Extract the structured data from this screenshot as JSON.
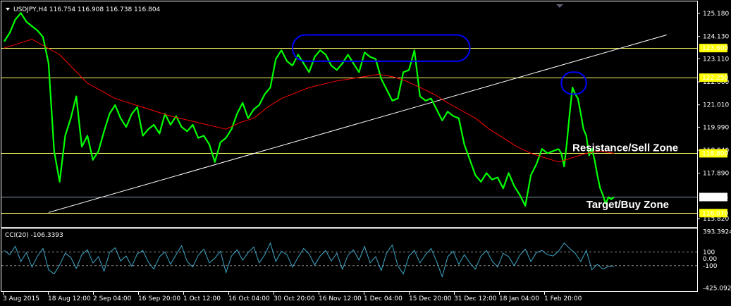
{
  "colors": {
    "background": "#000000",
    "frame": "#ffffff",
    "price": "#00ff00",
    "moving_average": "#ff0000",
    "levels": "#ffff66",
    "trendline": "#ffffff",
    "highlight": "#0000ff",
    "cci": "#3fa7c8",
    "current_price_line": "#8aa0b0",
    "current_price_label_bg": "#ffffff",
    "level_label_bg": "#ffff00"
  },
  "chart_data": [
    {
      "type": "line",
      "title": "USDJPY,H4  116.754 116.908 116.738 116.804",
      "symbol": "USDJPY,H4",
      "ohlc": {
        "open": 116.754,
        "high": 116.908,
        "low": 116.738,
        "close": 116.804
      },
      "x_labels": [
        "3 Aug 2015",
        "18 Aug 12:00",
        "2 Sep 04:00",
        "16 Sep 20:00",
        "1 Oct 12:00",
        "16 Oct 04:00",
        "30 Oct 20:00",
        "16 Nov 12:00",
        "1 Dec 04:00",
        "15 Dec 20:00",
        "31 Dec 12:00",
        "18 Jan 04:00",
        "1 Feb 20:00"
      ],
      "y_ticks": [
        "125.180",
        "124.130",
        "123.110",
        "122.060",
        "121.010",
        "119.990",
        "118.940",
        "117.890",
        "115.820"
      ],
      "ylim": [
        115.5,
        125.6
      ],
      "grid": false,
      "series": [
        {
          "series_kind": "price",
          "x": [
            0,
            2,
            4,
            6,
            8,
            10,
            12,
            14,
            16,
            18,
            20,
            22,
            24,
            26,
            28,
            30,
            32,
            34,
            36,
            38,
            40,
            42,
            44,
            46,
            48,
            50,
            52,
            54,
            56,
            58,
            60,
            62,
            64,
            66,
            68,
            70,
            72,
            74,
            76,
            78,
            80,
            82,
            84,
            86,
            88,
            90,
            92,
            94,
            96,
            98,
            100,
            102,
            104,
            106,
            108,
            110,
            112,
            114,
            116,
            118,
            120,
            122,
            124,
            126,
            128,
            130,
            132,
            134,
            136,
            138,
            140,
            142,
            144,
            146,
            148,
            150,
            152,
            154,
            156,
            158,
            160,
            162,
            164,
            166,
            168,
            170,
            172,
            174,
            176,
            178,
            180,
            182,
            184,
            186,
            188,
            190,
            192,
            194,
            196,
            198,
            200
          ],
          "values": [
            123.9,
            124.3,
            124.9,
            125.2,
            124.8,
            124.6,
            124.4,
            124.1,
            122.9,
            118.9,
            117.5,
            119.6,
            120.4,
            121.4,
            119.1,
            119.6,
            118.5,
            118.9,
            119.8,
            120.6,
            121.0,
            120.4,
            120.0,
            120.6,
            120.9,
            119.6,
            119.9,
            120.1,
            119.7,
            120.6,
            120.1,
            120.5,
            120.0,
            119.8,
            120.1,
            119.5,
            119.6,
            119.2,
            118.4,
            119.3,
            119.5,
            119.9,
            120.6,
            121.1,
            120.4,
            120.8,
            121.0,
            121.5,
            121.8,
            123.1,
            123.5,
            123.0,
            122.8,
            123.3,
            122.9,
            122.5,
            123.2,
            123.5,
            123.3,
            122.8,
            122.6,
            122.9,
            123.3,
            122.9,
            122.5,
            123.4,
            123.2,
            123.1,
            122.2,
            121.7,
            121.2,
            121.3,
            122.5,
            122.6,
            123.5,
            121.4,
            121.2,
            121.3,
            120.8,
            120.3,
            120.7,
            120.5,
            120.4,
            119.2,
            118.5,
            117.8,
            117.5,
            117.9,
            117.6,
            117.7,
            117.2,
            117.9,
            117.3,
            116.9,
            116.4,
            117.8,
            118.3,
            119.0,
            118.8,
            118.9,
            119.0
          ]
        },
        {
          "series_kind": "moving_average",
          "x": [
            0,
            10,
            20,
            30,
            40,
            50,
            60,
            70,
            80,
            85,
            90,
            95,
            100,
            110,
            120,
            130,
            135,
            140,
            145,
            150,
            155,
            160,
            170,
            175,
            180,
            185,
            190,
            195,
            200
          ],
          "values": [
            123.6,
            124.0,
            123.3,
            122.0,
            121.3,
            120.9,
            120.5,
            120.2,
            119.9,
            120.2,
            120.4,
            120.9,
            121.3,
            121.8,
            122.1,
            122.3,
            122.4,
            122.3,
            122.1,
            121.8,
            121.5,
            121.1,
            120.4,
            119.9,
            119.5,
            119.1,
            118.8,
            118.6,
            118.4
          ]
        },
        {
          "series_kind": "price",
          "x": [
            200,
            201,
            202,
            203,
            204,
            205,
            206,
            207,
            208,
            209,
            210,
            211,
            212,
            213,
            214,
            215,
            216,
            217,
            218,
            219,
            220
          ],
          "values": [
            119.0,
            118.8,
            118.2,
            119.3,
            120.6,
            121.8,
            121.5,
            121.3,
            120.6,
            119.9,
            119.6,
            118.7,
            119.0,
            118.5,
            117.8,
            117.2,
            116.9,
            116.5,
            116.8,
            116.7,
            116.804
          ]
        },
        {
          "series_kind": "moving_average",
          "x": [
            200,
            205,
            210,
            215,
            220
          ],
          "values": [
            118.4,
            118.6,
            118.8,
            118.9,
            118.8
          ]
        }
      ],
      "levels": [
        {
          "value": 123.6,
          "label": "123.600"
        },
        {
          "value": 122.25,
          "label": "122.250"
        },
        {
          "value": 118.8,
          "label": "118.800"
        },
        {
          "value": 116.07,
          "label": "116.070"
        }
      ],
      "current_price": {
        "value": 116.804,
        "label": "116.804"
      },
      "trendline": {
        "from": {
          "x": 16,
          "value": 116.1
        },
        "to": {
          "x": 239,
          "value": 124.2
        }
      },
      "highlights": [
        {
          "x_range": [
            104,
            168
          ],
          "value_range": [
            123.0,
            124.2
          ]
        },
        {
          "x_range": [
            201,
            210
          ],
          "value_range": [
            121.5,
            122.5
          ]
        }
      ],
      "annotations": [
        {
          "text": "Resistance/Sell Zone",
          "x": 205,
          "value": 118.9
        },
        {
          "text": "Target/Buy Zone",
          "x": 210,
          "value": 116.3
        }
      ]
    },
    {
      "type": "line",
      "title": "CCI(20) -106.3393",
      "ylim": [
        -450,
        420
      ],
      "y_ticks": [
        "393.3924",
        "100",
        "0.00",
        "-100",
        "-425.0924"
      ],
      "levels": [
        100,
        -100
      ],
      "series": [
        {
          "x": [
            0,
            2,
            4,
            6,
            8,
            10,
            12,
            14,
            16,
            18,
            20,
            22,
            24,
            26,
            28,
            30,
            32,
            34,
            36,
            38,
            40,
            42,
            44,
            46,
            48,
            50,
            52,
            54,
            56,
            58,
            60,
            62,
            64,
            66,
            68,
            70,
            72,
            74,
            76,
            78,
            80,
            82,
            84,
            86,
            88,
            90,
            92,
            94,
            96,
            98,
            100,
            102,
            104,
            106,
            108,
            110,
            112,
            114,
            116,
            118,
            120,
            122,
            124,
            126,
            128,
            130,
            132,
            134,
            136,
            138,
            140,
            142,
            144,
            146,
            148,
            150,
            152,
            154,
            156,
            158,
            160,
            162,
            164,
            166,
            168,
            170,
            172,
            174,
            176,
            178,
            180,
            182,
            184,
            186,
            188,
            190,
            192,
            194,
            196,
            198,
            200,
            202,
            204,
            206,
            208,
            210,
            212,
            214,
            216,
            218,
            220
          ],
          "values": [
            120,
            60,
            180,
            -40,
            90,
            -120,
            40,
            150,
            -160,
            -220,
            -90,
            80,
            20,
            -140,
            60,
            130,
            -60,
            30,
            -180,
            90,
            160,
            -30,
            40,
            -110,
            70,
            120,
            -50,
            -150,
            30,
            100,
            -80,
            60,
            190,
            -40,
            -120,
            50,
            140,
            -60,
            10,
            110,
            -200,
            40,
            130,
            -20,
            90,
            170,
            -60,
            60,
            230,
            -40,
            110,
            60,
            -120,
            20,
            150,
            70,
            -90,
            40,
            120,
            -30,
            80,
            -150,
            50,
            130,
            -20,
            180,
            -60,
            30,
            -170,
            90,
            200,
            -100,
            -220,
            40,
            120,
            -60,
            60,
            150,
            -40,
            -260,
            30,
            110,
            -80,
            60,
            -60,
            -150,
            40,
            120,
            -30,
            -120,
            80,
            30,
            -100,
            50,
            140,
            -40,
            90,
            120,
            60,
            40,
            110,
            230,
            150,
            80,
            -40,
            120,
            -160,
            -80,
            -150,
            -110,
            -106.3393
          ]
        }
      ]
    }
  ]
}
